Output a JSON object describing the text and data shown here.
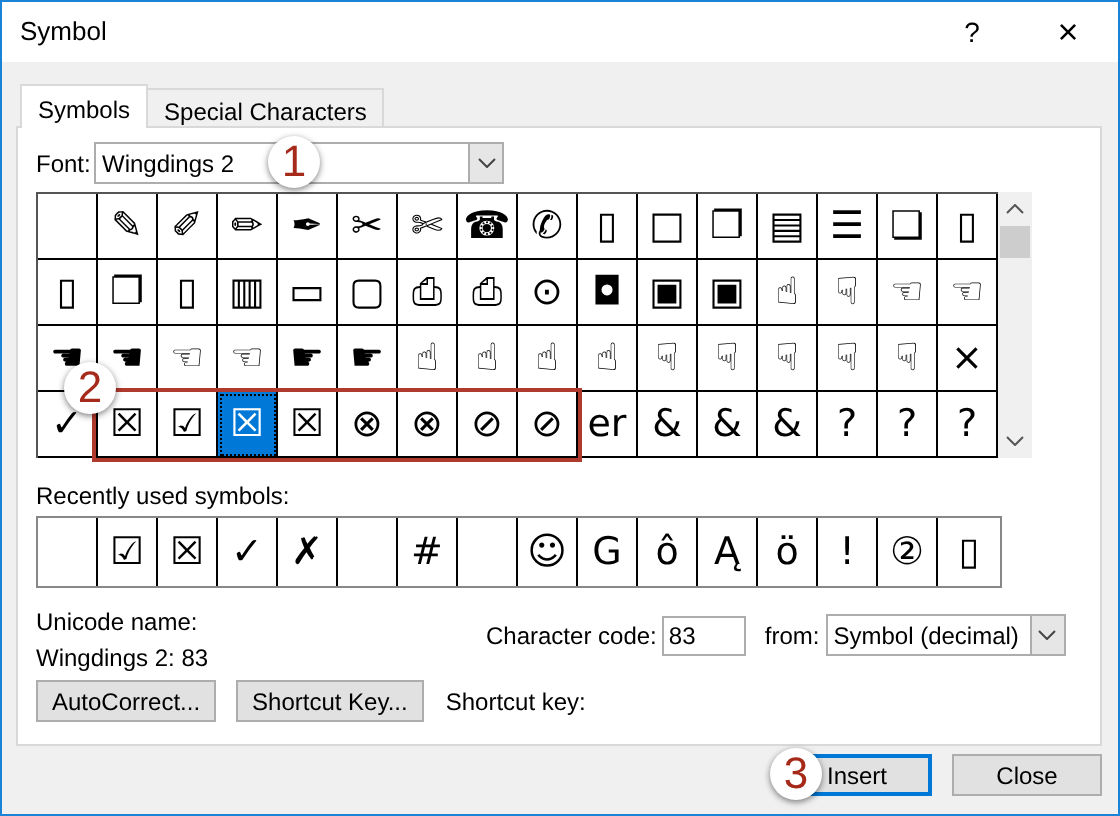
{
  "window": {
    "title": "Symbol",
    "help": "?",
    "close": "×"
  },
  "tabs": [
    {
      "label": "Symbols",
      "selected": true
    },
    {
      "label": "Special Characters",
      "selected": false
    }
  ],
  "font": {
    "label": "Font:",
    "value": "Wingdings 2"
  },
  "symbol_grid": [
    [
      {
        "selected": false,
        "highlighted": false
      },
      {
        "symbol": "✎",
        "selected": false,
        "highlighted": false
      },
      {
        "symbol": "✐",
        "selected": false,
        "highlighted": false
      },
      {
        "symbol": "✏",
        "selected": false,
        "highlighted": false
      },
      {
        "symbol": "✒",
        "selected": false,
        "highlighted": false
      },
      {
        "symbol": "✂",
        "selected": false,
        "highlighted": false
      },
      {
        "symbol": "✄",
        "selected": false,
        "highlighted": false
      },
      {
        "symbol": "☎",
        "selected": false,
        "highlighted": false
      },
      {
        "symbol": "✆",
        "selected": false,
        "highlighted": false
      },
      {
        "symbol": "▯",
        "selected": false,
        "highlighted": false
      },
      {
        "symbol": "□",
        "selected": false,
        "highlighted": false
      },
      {
        "symbol": "❐",
        "selected": false,
        "highlighted": false
      },
      {
        "symbol": "▤",
        "selected": false,
        "highlighted": false
      },
      {
        "symbol": "☰",
        "selected": false,
        "highlighted": false
      },
      {
        "symbol": "❏",
        "selected": false,
        "highlighted": false
      },
      {
        "symbol": "▯",
        "selected": false,
        "highlighted": false
      }
    ],
    [
      {
        "symbol": "▯",
        "selected": false,
        "highlighted": false
      },
      {
        "symbol": "❐",
        "selected": false,
        "highlighted": false
      },
      {
        "symbol": "▯",
        "selected": false,
        "highlighted": false
      },
      {
        "symbol": "▥",
        "selected": false,
        "highlighted": false
      },
      {
        "symbol": "▭",
        "selected": false,
        "highlighted": false
      },
      {
        "symbol": "▢",
        "selected": false,
        "highlighted": false
      },
      {
        "symbol": "⎙",
        "selected": false,
        "highlighted": false
      },
      {
        "symbol": "⎙",
        "selected": false,
        "highlighted": false
      },
      {
        "symbol": "⊙",
        "selected": false,
        "highlighted": false
      },
      {
        "symbol": "◘",
        "selected": false,
        "highlighted": false
      },
      {
        "symbol": "▣",
        "selected": false,
        "highlighted": false
      },
      {
        "symbol": "▣",
        "selected": false,
        "highlighted": false
      },
      {
        "symbol": "☝",
        "selected": false,
        "highlighted": false
      },
      {
        "symbol": "☟",
        "selected": false,
        "highlighted": false
      },
      {
        "symbol": "☜",
        "selected": false,
        "highlighted": false
      },
      {
        "symbol": "☜",
        "selected": false,
        "highlighted": false
      }
    ],
    [
      {
        "symbol": "☚",
        "selected": false,
        "highlighted": false
      },
      {
        "symbol": "☚",
        "selected": false,
        "highlighted": false
      },
      {
        "symbol": "☜",
        "selected": false,
        "highlighted": false
      },
      {
        "symbol": "☜",
        "selected": false,
        "highlighted": false
      },
      {
        "symbol": "☛",
        "selected": false,
        "highlighted": false
      },
      {
        "symbol": "☛",
        "selected": false,
        "highlighted": false
      },
      {
        "symbol": "☝",
        "selected": false,
        "highlighted": false
      },
      {
        "symbol": "☝",
        "selected": false,
        "highlighted": false
      },
      {
        "symbol": "☝",
        "selected": false,
        "highlighted": false
      },
      {
        "symbol": "☝",
        "selected": false,
        "highlighted": false
      },
      {
        "symbol": "☟",
        "selected": false,
        "highlighted": false
      },
      {
        "symbol": "☟",
        "selected": false,
        "highlighted": false
      },
      {
        "symbol": "☟",
        "selected": false,
        "highlighted": false
      },
      {
        "symbol": "☟",
        "selected": false,
        "highlighted": false
      },
      {
        "symbol": "☟",
        "selected": false,
        "highlighted": false
      },
      {
        "symbol": "×",
        "selected": false,
        "highlighted": false
      }
    ],
    [
      {
        "symbol": "✓",
        "selected": false,
        "highlighted": false
      },
      {
        "symbol": "☒",
        "selected": false,
        "highlighted": true
      },
      {
        "symbol": "☑",
        "selected": false,
        "highlighted": true
      },
      {
        "symbol": "☒",
        "selected": true,
        "highlighted": true
      },
      {
        "symbol": "☒",
        "selected": false,
        "highlighted": true
      },
      {
        "symbol": "⊗",
        "selected": false,
        "highlighted": true
      },
      {
        "symbol": "⊗",
        "selected": false,
        "highlighted": true
      },
      {
        "symbol": "⊘",
        "selected": false,
        "highlighted": true
      },
      {
        "symbol": "⊘",
        "selected": false,
        "highlighted": true
      },
      {
        "symbol": "er",
        "selected": false,
        "highlighted": false
      },
      {
        "symbol": "&",
        "selected": false,
        "highlighted": false
      },
      {
        "symbol": "&",
        "selected": false,
        "highlighted": false
      },
      {
        "symbol": "&",
        "selected": false,
        "highlighted": false
      },
      {
        "symbol": "?",
        "selected": false,
        "highlighted": false
      },
      {
        "symbol": "?",
        "selected": false,
        "highlighted": false
      },
      {
        "symbol": "?",
        "selected": false,
        "highlighted": false
      }
    ]
  ],
  "recent": {
    "label": "Recently used symbols:",
    "cells": [
      {},
      {
        "symbol": "☑"
      },
      {
        "symbol": "☒"
      },
      {
        "symbol": "✓"
      },
      {
        "symbol": "✗"
      },
      {},
      {
        "symbol": "#"
      },
      {},
      {
        "symbol": "☺"
      },
      {
        "symbol": "G"
      },
      {
        "symbol": "ô"
      },
      {
        "symbol": "Ą"
      },
      {
        "symbol": "ö"
      },
      {
        "symbol": "!"
      },
      {
        "symbol": "②"
      },
      {
        "symbol": "▯"
      }
    ]
  },
  "unicode_name": {
    "label": "Unicode name:",
    "value": "Wingdings 2: 83"
  },
  "character_code": {
    "label": "Character code:",
    "value": "83"
  },
  "from": {
    "label": "from:",
    "value": "Symbol (decimal)"
  },
  "panel_buttons": [
    "AutoCorrect...",
    "Shortcut Key..."
  ],
  "shortcut_key_label": "Shortcut key:",
  "dialog_buttons": [
    {
      "label": "Insert",
      "default": true
    },
    {
      "label": "Close",
      "default": false
    }
  ],
  "callouts": [
    {
      "label": "1"
    },
    {
      "label": "2"
    },
    {
      "label": "3"
    }
  ]
}
